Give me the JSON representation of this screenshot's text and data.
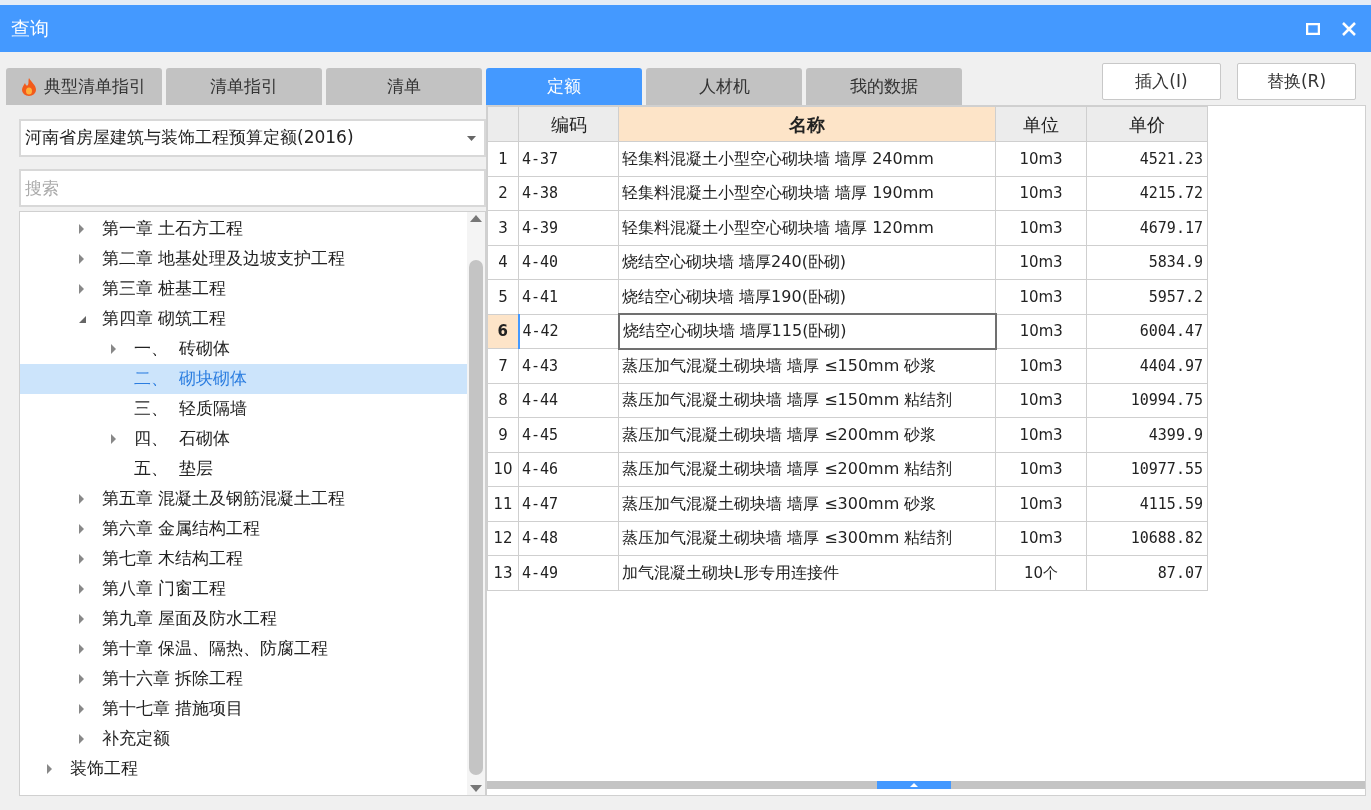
{
  "window": {
    "title": "查询"
  },
  "tabs": [
    {
      "label": "典型清单指引",
      "selected": false,
      "hot": true
    },
    {
      "label": "清单指引",
      "selected": false,
      "hot": false
    },
    {
      "label": "清单",
      "selected": false,
      "hot": false
    },
    {
      "label": "定额",
      "selected": true,
      "hot": false
    },
    {
      "label": "人材机",
      "selected": false,
      "hot": false
    },
    {
      "label": "我的数据",
      "selected": false,
      "hot": false
    }
  ],
  "buttons": [
    "插入(I)",
    "替换(R)"
  ],
  "quota_select": {
    "value": "河南省房屋建筑与装饰工程预算定额(2016)"
  },
  "search": {
    "placeholder": "搜索"
  },
  "tree": [
    {
      "children": [
        {
          "label": "第一章 土石方工程",
          "expandable": true,
          "expanded": false,
          "selected": false
        },
        {
          "label": "第二章 地基处理及边坡支护工程",
          "expandable": true,
          "expanded": false,
          "selected": false
        },
        {
          "label": "第三章 桩基工程",
          "expandable": true,
          "expanded": false,
          "selected": false
        },
        {
          "label": "第四章 砌筑工程",
          "expandable": true,
          "expanded": true,
          "selected": false,
          "children": [
            {
              "label": "一、  砖砌体",
              "expandable": true,
              "expanded": false,
              "selected": false
            },
            {
              "label": "二、  砌块砌体",
              "expandable": false,
              "expanded": false,
              "selected": true
            },
            {
              "label": "三、  轻质隔墙",
              "expandable": false,
              "expanded": false,
              "selected": false
            },
            {
              "label": "四、  石砌体",
              "expandable": true,
              "expanded": false,
              "selected": false
            },
            {
              "label": "五、  垫层",
              "expandable": false,
              "expanded": false,
              "selected": false
            }
          ]
        },
        {
          "label": "第五章 混凝土及钢筋混凝土工程",
          "expandable": true,
          "expanded": false,
          "selected": false
        },
        {
          "label": "第六章 金属结构工程",
          "expandable": true,
          "expanded": false,
          "selected": false
        },
        {
          "label": "第七章 木结构工程",
          "expandable": true,
          "expanded": false,
          "selected": false
        },
        {
          "label": "第八章 门窗工程",
          "expandable": true,
          "expanded": false,
          "selected": false
        },
        {
          "label": "第九章 屋面及防水工程",
          "expandable": true,
          "expanded": false,
          "selected": false
        },
        {
          "label": "第十章 保温、隔热、防腐工程",
          "expandable": true,
          "expanded": false,
          "selected": false
        },
        {
          "label": "第十六章 拆除工程",
          "expandable": true,
          "expanded": false,
          "selected": false
        },
        {
          "label": "第十七章 措施项目",
          "expandable": true,
          "expanded": false,
          "selected": false
        },
        {
          "label": "补充定额",
          "expandable": true,
          "expanded": false,
          "selected": false
        }
      ]
    },
    {
      "label": "装饰工程",
      "expandable": true,
      "expanded": false,
      "selected": false
    }
  ],
  "table": {
    "columns": [
      {
        "label": "编码",
        "selected": false
      },
      {
        "label": "名称",
        "selected": true
      },
      {
        "label": "单位",
        "selected": false
      },
      {
        "label": "单价",
        "selected": false
      }
    ],
    "rows": [
      {
        "index": "1",
        "code": "4-37",
        "name": "轻集料混凝土小型空心砌块墙 墙厚 240mm",
        "unit": "10m3",
        "price": "4521.23",
        "selected": false
      },
      {
        "index": "2",
        "code": "4-38",
        "name": "轻集料混凝土小型空心砌块墙 墙厚 190mm",
        "unit": "10m3",
        "price": "4215.72",
        "selected": false
      },
      {
        "index": "3",
        "code": "4-39",
        "name": "轻集料混凝土小型空心砌块墙 墙厚 120mm",
        "unit": "10m3",
        "price": "4679.17",
        "selected": false
      },
      {
        "index": "4",
        "code": "4-40",
        "name": "烧结空心砌块墙 墙厚240(卧砌)",
        "unit": "10m3",
        "price": "5834.9",
        "selected": false
      },
      {
        "index": "5",
        "code": "4-41",
        "name": "烧结空心砌块墙 墙厚190(卧砌)",
        "unit": "10m3",
        "price": "5957.2",
        "selected": false
      },
      {
        "index": "6",
        "code": "4-42",
        "name": "烧结空心砌块墙 墙厚115(卧砌)",
        "unit": "10m3",
        "price": "6004.47",
        "selected": true
      },
      {
        "index": "7",
        "code": "4-43",
        "name": "蒸压加气混凝土砌块墙 墙厚 ≤150mm 砂浆",
        "unit": "10m3",
        "price": "4404.97",
        "selected": false
      },
      {
        "index": "8",
        "code": "4-44",
        "name": "蒸压加气混凝土砌块墙 墙厚 ≤150mm 粘结剂",
        "unit": "10m3",
        "price": "10994.75",
        "selected": false
      },
      {
        "index": "9",
        "code": "4-45",
        "name": "蒸压加气混凝土砌块墙 墙厚 ≤200mm 砂浆",
        "unit": "10m3",
        "price": "4399.9",
        "selected": false
      },
      {
        "index": "10",
        "code": "4-46",
        "name": "蒸压加气混凝土砌块墙 墙厚 ≤200mm 粘结剂",
        "unit": "10m3",
        "price": "10977.55",
        "selected": false
      },
      {
        "index": "11",
        "code": "4-47",
        "name": "蒸压加气混凝土砌块墙 墙厚 ≤300mm 砂浆",
        "unit": "10m3",
        "price": "4115.59",
        "selected": false
      },
      {
        "index": "12",
        "code": "4-48",
        "name": "蒸压加气混凝土砌块墙 墙厚 ≤300mm 粘结剂",
        "unit": "10m3",
        "price": "10688.82",
        "selected": false
      },
      {
        "index": "13",
        "code": "4-49",
        "name": "加气混凝土砌块L形专用连接件",
        "unit": "10个",
        "price": "87.07",
        "selected": false
      }
    ]
  }
}
